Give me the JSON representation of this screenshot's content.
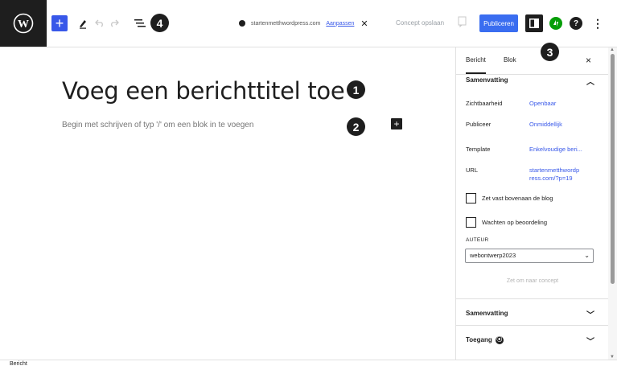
{
  "toolbar": {
    "callout": "4",
    "site_url": "startenmetthwordpress.com",
    "change_link": "Aanpassen",
    "save_draft": "Concept opslaan",
    "publish_label": "Publiceren",
    "help_label": "?",
    "more_label": "⋮"
  },
  "editor": {
    "title_placeholder": "Voeg een berichttitel toe",
    "title_callout": "1",
    "block_placeholder": "Begin met schrijven of typ '/' om een blok in te voegen",
    "block_callout": "2",
    "inline_add": "+"
  },
  "sidebar": {
    "tabs": [
      {
        "label": "Bericht",
        "active": true
      },
      {
        "label": "Blok",
        "active": false
      }
    ],
    "callout": "3",
    "close_label": "×",
    "summary_panel": {
      "title": "Samenvatting",
      "rows": [
        {
          "label": "Zichtbaarheid",
          "value": "Openbaar"
        },
        {
          "label": "Publiceer",
          "value": "Onmiddellijk"
        },
        {
          "label": "Template",
          "value": "Enkelvoudige beri..."
        },
        {
          "label": "URL",
          "value": "startenmetthwordp ress.com/?p=19"
        }
      ],
      "checkbox_sticky": "Zet vast bovenaan de blog",
      "checkbox_pending": "Wachten op beoordeling",
      "author_label": "AUTEUR",
      "author_value": "webontwerp2023",
      "pending_button": "Zet om naar concept"
    },
    "collapsed_panels": [
      {
        "title": "Samenvatting"
      },
      {
        "title": "Toegang"
      }
    ]
  },
  "footer": {
    "breadcrumb": "Bericht"
  },
  "colors": {
    "accent": "#3858e9",
    "dark": "#1e1e1e",
    "jetpack": "#069e08"
  }
}
